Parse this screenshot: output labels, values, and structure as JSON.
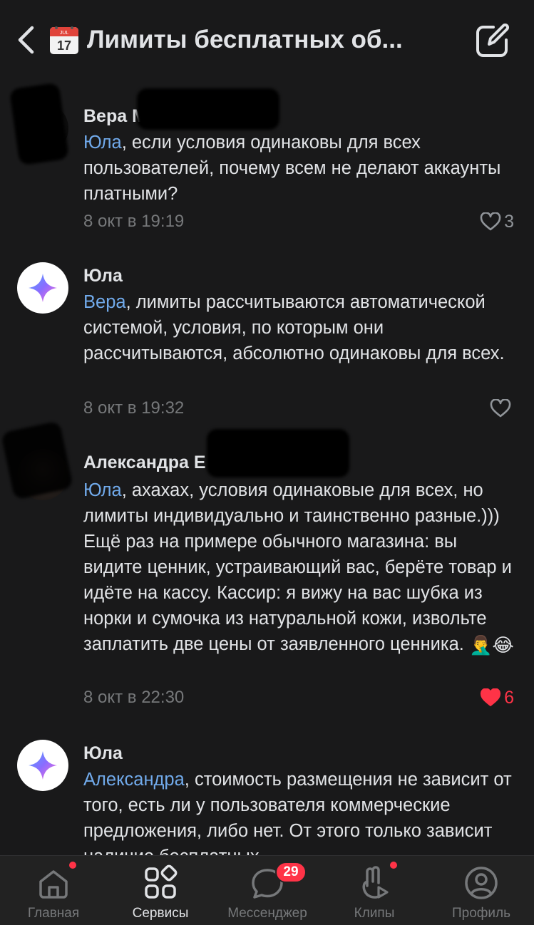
{
  "header": {
    "title": "Лимиты бесплатных об...",
    "calendar_icon": "calendar-icon",
    "back_icon": "chevron-left-icon",
    "edit_icon": "edit-icon"
  },
  "comments": [
    {
      "author": "Вера М",
      "mention": "Юла",
      "text": ", если условия одинаковы для всех пользователей, почему всем не делают аккаунты платными?",
      "time": "8 окт в 19:19",
      "likes": "3",
      "liked": false
    },
    {
      "author": "Юла",
      "mention": "Вера",
      "text": ", лимиты рассчитываются автоматической системой, условия, по которым они рассчитываются, абсолютно одинаковы для всех.",
      "time": "8 окт в 19:32",
      "likes": "",
      "liked": false
    },
    {
      "author": "Александра Е",
      "mention": "Юла",
      "text": ", ахахах, условия одинаковые для всех, но лимиты индивидуально и таинственно разные.))) Ещё раз на примере обычного магазина: вы видите ценник, устраивающий вас, берёте товар и идёте на кассу. Кассир: я вижу на вас шубка из норки и сумочка из натуральной кожи, извольте заплатить две цены от заявленного ценника.",
      "emoji_1": "🤦‍♂️",
      "emoji_2": "😂",
      "time": "8 окт в 22:30",
      "likes": "6",
      "liked": true
    },
    {
      "author": "Юла",
      "mention": "Александра",
      "text": ", стоимость размещения не зависит от того, есть ли у пользователя коммерческие предложения, либо нет. От этого только зависит наличие бесплатных",
      "time": "",
      "likes": "",
      "liked": false
    }
  ],
  "tabbar": {
    "tabs": [
      {
        "label": "Главная",
        "icon": "home-icon",
        "dot": true
      },
      {
        "label": "Сервисы",
        "icon": "services-icon",
        "active": true
      },
      {
        "label": "Мессенджер",
        "icon": "messenger-icon",
        "badge": "29"
      },
      {
        "label": "Клипы",
        "icon": "clips-icon",
        "dot": true
      },
      {
        "label": "Профиль",
        "icon": "profile-icon"
      }
    ]
  },
  "colors": {
    "background": "#19191a",
    "text": "#e1e3e6",
    "mention": "#71aaeb",
    "secondary": "#76787a",
    "like_active": "#ff3347"
  }
}
